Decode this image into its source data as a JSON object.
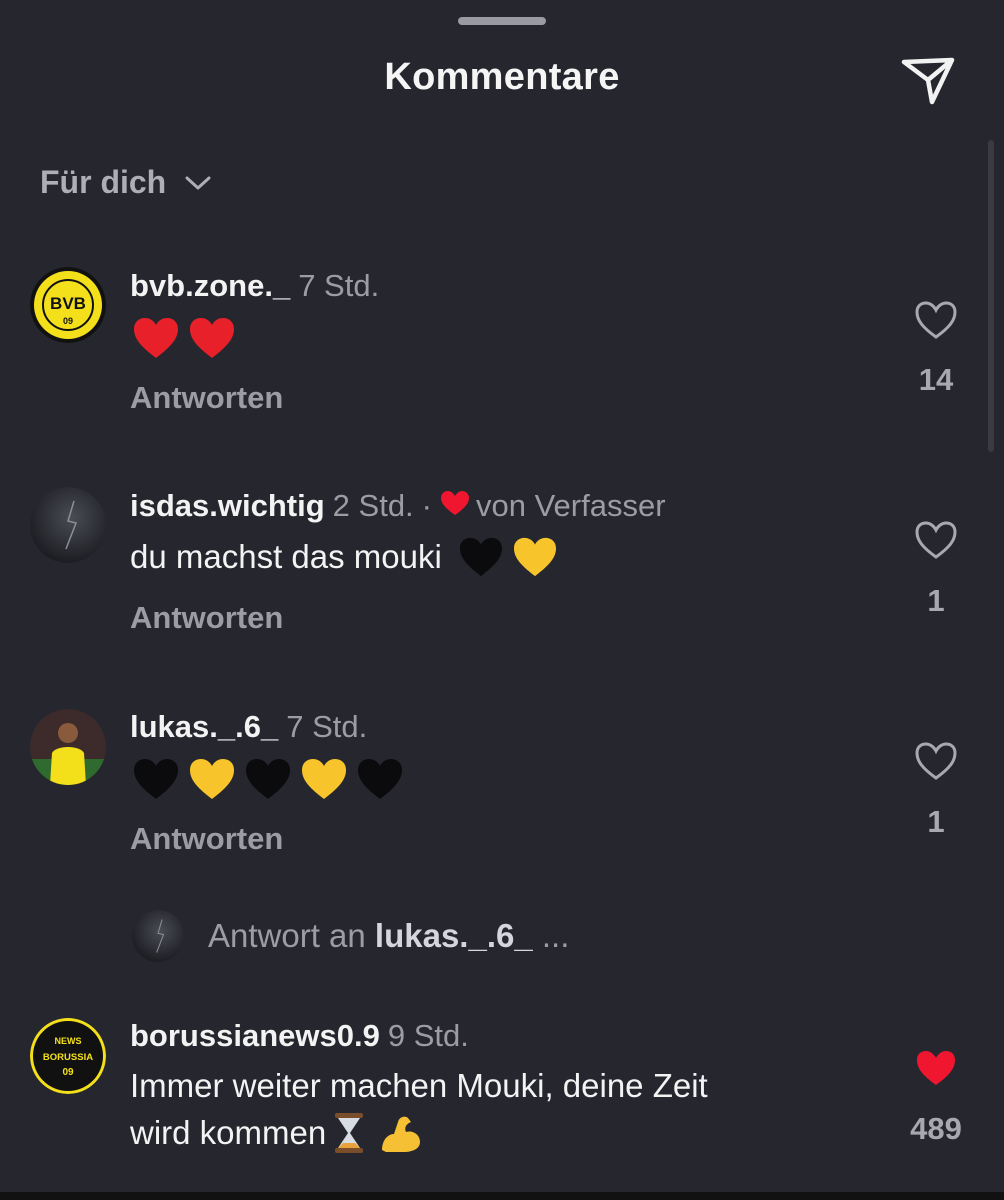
{
  "header": {
    "title": "Kommentare"
  },
  "sort": {
    "label": "Für dich"
  },
  "comments": [
    {
      "username": "bvb.zone._",
      "time": "7 Std.",
      "text": "",
      "emojis": [
        "red-heart",
        "red-heart"
      ],
      "reply_label": "Antworten",
      "likes": "14",
      "liked": false,
      "avatar_text": [
        "BORUSSIA DORTMUND",
        "BVB",
        "09",
        "BVB.ZONE"
      ]
    },
    {
      "username": "isdas.wichtig",
      "time": "2 Std.",
      "separator": "·",
      "author_badge": "von Verfasser",
      "text": "du machst das mouki",
      "emojis": [
        "black-heart",
        "yellow-heart"
      ],
      "reply_label": "Antworten",
      "likes": "1",
      "liked": false
    },
    {
      "username": "lukas._.6_",
      "time": "7 Std.",
      "text": "",
      "emojis": [
        "black-heart",
        "yellow-heart",
        "black-heart",
        "yellow-heart",
        "black-heart"
      ],
      "reply_label": "Antworten",
      "likes": "1",
      "liked": false
    },
    {
      "username": "borussianews0.9",
      "time": "9 Std.",
      "text_line1": "Immer weiter machen Mouki, deine Zeit",
      "text_line2": "wird kommen",
      "emojis": [
        "hourglass",
        "flexed-biceps"
      ],
      "likes": "489",
      "liked": true,
      "avatar_text": [
        "NEWS",
        "BORUSSIA",
        "09"
      ]
    }
  ],
  "replies_link": {
    "prefix": "Antwort an",
    "target": "lukas._.6_",
    "suffix": "..."
  },
  "colors": {
    "background": "#26272e",
    "liked_red": "#f0162f",
    "yellow_heart": "#f7c52b"
  }
}
